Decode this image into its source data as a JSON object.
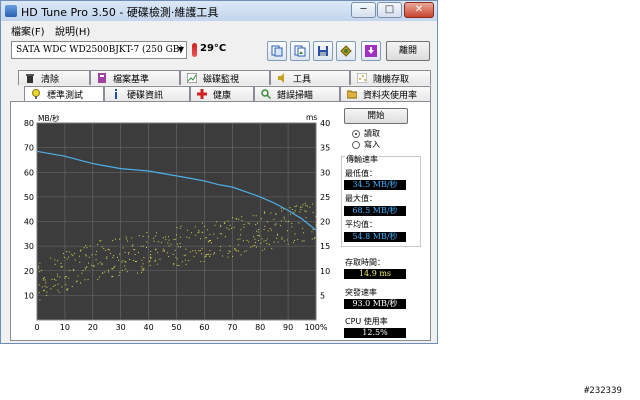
{
  "window": {
    "title": "HD Tune Pro 3.50 - 硬碟檢測‧維護工具",
    "controls": {
      "minimize": "─",
      "maximize": "□",
      "close": "✕"
    }
  },
  "menu": [
    "檔案(F)",
    "說明(H)"
  ],
  "toolbar": {
    "drive": "SATA    WDC WD2500BJKT-7 (250 GB)",
    "temperature": "29°C",
    "exit_label": "離開",
    "icons": [
      "copy-text-icon",
      "copy-image-icon",
      "save-icon",
      "options-icon",
      "download-icon"
    ]
  },
  "tabs_top": [
    {
      "label": "清除",
      "icon": "trash-icon",
      "color": "#333333"
    },
    {
      "label": "檔案基準",
      "icon": "file-benchmark-icon",
      "color": "#a040a0"
    },
    {
      "label": "磁碟監視",
      "icon": "disk-monitor-icon",
      "color": "#3a8a3a"
    },
    {
      "label": "工具",
      "icon": "speaker-icon",
      "color": "#c8a020"
    },
    {
      "label": "隨機存取",
      "icon": "random-access-icon",
      "color": "#d0a040"
    }
  ],
  "tabs_bottom": [
    {
      "label": "標準測試",
      "icon": "benchmark-icon",
      "color": "#d0c020",
      "active": true
    },
    {
      "label": "硬碟資訊",
      "icon": "info-icon",
      "color": "#2050a0",
      "active": false
    },
    {
      "label": "健康",
      "icon": "health-cross-icon",
      "color": "#d02020",
      "active": false
    },
    {
      "label": "錯誤掃瞄",
      "icon": "error-scan-icon",
      "color": "#3a8a3a",
      "active": false
    },
    {
      "label": "資料夾使用率",
      "icon": "folder-icon",
      "color": "#e0b040",
      "active": false
    }
  ],
  "benchmark": {
    "start_label": "開始",
    "mode_read": "讀取",
    "mode_write": "寫入",
    "selected_mode": "讀取",
    "group_title": "傳輸速率",
    "min_label": "最低值：",
    "min_value": "34.5 MB/秒",
    "max_label": "最大值：",
    "max_value": "68.5 MB/秒",
    "avg_label": "平均值：",
    "avg_value": "54.8 MB/秒",
    "access_label": "存取時間：",
    "access_value": "14.9 ms",
    "burst_label": "突發速率",
    "burst_value": "93.0 MB/秒",
    "cpu_label": "CPU 使用率",
    "cpu_value": "12.5%"
  },
  "chart_data": {
    "type": "line",
    "ylabel_left": "MB/秒",
    "ylabel_right": "ms",
    "x_ticks": [
      "0",
      "10",
      "20",
      "30",
      "40",
      "50",
      "60",
      "70",
      "80",
      "90",
      "100%"
    ],
    "y_left_ticks": [
      "80",
      "70",
      "60",
      "50",
      "40",
      "30",
      "20",
      "10"
    ],
    "y_right_ticks": [
      "40",
      "35",
      "30",
      "25",
      "20",
      "15",
      "10",
      "5"
    ],
    "xlim": [
      0,
      100
    ],
    "ylim_left": [
      0,
      80
    ],
    "ylim_right": [
      0,
      40
    ],
    "grid": true,
    "background": "#3c3c3c",
    "series": [
      {
        "kind": "transfer-rate",
        "color": "#4db0e8",
        "x": [
          0,
          5,
          10,
          15,
          20,
          25,
          30,
          35,
          40,
          45,
          50,
          55,
          60,
          65,
          70,
          75,
          80,
          85,
          90,
          95,
          100
        ],
        "y": [
          68.5,
          67.5,
          66.5,
          65,
          63.5,
          62.5,
          61.5,
          61,
          60.5,
          59.5,
          58.5,
          57.5,
          56.5,
          55,
          54,
          52,
          50,
          47.5,
          44.5,
          41,
          36.5
        ]
      },
      {
        "kind": "access-time",
        "color": "#d8d850",
        "x": [
          0,
          5,
          10,
          15,
          20,
          25,
          30,
          35,
          40,
          45,
          50,
          55,
          60,
          65,
          70,
          75,
          80,
          85,
          90,
          95,
          100
        ],
        "y": [
          7.5,
          9,
          10,
          11,
          12,
          12.5,
          13,
          13.5,
          14,
          14.5,
          15,
          15.5,
          16,
          16.5,
          17,
          17.5,
          18,
          18.5,
          19.5,
          20,
          20.5
        ],
        "spread": 4
      }
    ]
  },
  "watermark": "#232339"
}
